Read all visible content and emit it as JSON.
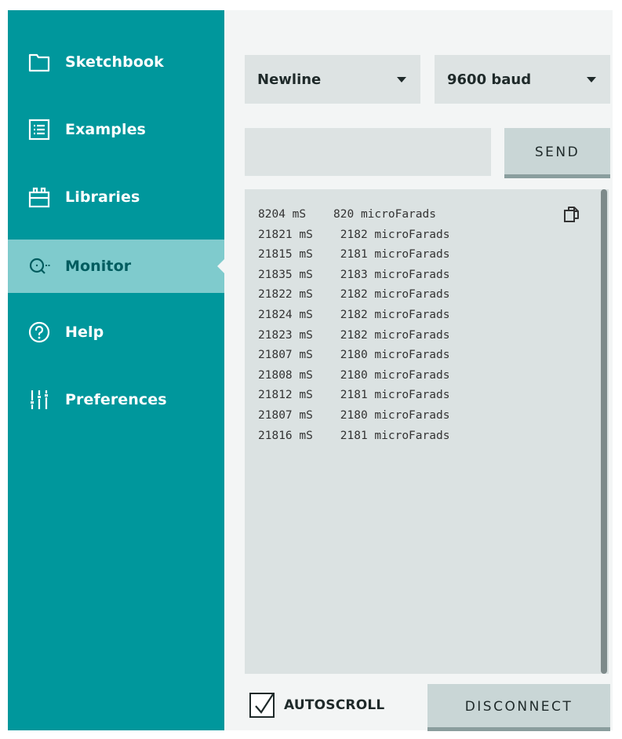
{
  "sidebar": {
    "items": [
      {
        "label": "Sketchbook",
        "icon": "folder-icon"
      },
      {
        "label": "Examples",
        "icon": "list-icon"
      },
      {
        "label": "Libraries",
        "icon": "library-icon"
      },
      {
        "label": "Monitor",
        "icon": "monitor-icon",
        "active": true
      },
      {
        "label": "Help",
        "icon": "help-icon"
      },
      {
        "label": "Preferences",
        "icon": "preferences-icon"
      }
    ]
  },
  "monitor": {
    "line_ending": "Newline",
    "baud_rate": "9600 baud",
    "input_value": "",
    "send_label": "SEND",
    "output_lines": [
      "8204 mS    820 microFarads",
      "21821 mS    2182 microFarads",
      "21815 mS    2181 microFarads",
      "21835 mS    2183 microFarads",
      "21822 mS    2182 microFarads",
      "21824 mS    2182 microFarads",
      "21823 mS    2182 microFarads",
      "21807 mS    2180 microFarads",
      "21808 mS    2180 microFarads",
      "21812 mS    2181 microFarads",
      "21807 mS    2180 microFarads",
      "21816 mS    2181 microFarads"
    ],
    "autoscroll_label": "AUTOSCROLL",
    "autoscroll_checked": true,
    "disconnect_label": "DISCONNECT"
  },
  "colors": {
    "sidebar": "#00979c",
    "sidebar_active": "#7fcbcd",
    "panel": "#f3f5f5",
    "field": "#dde3e3"
  }
}
